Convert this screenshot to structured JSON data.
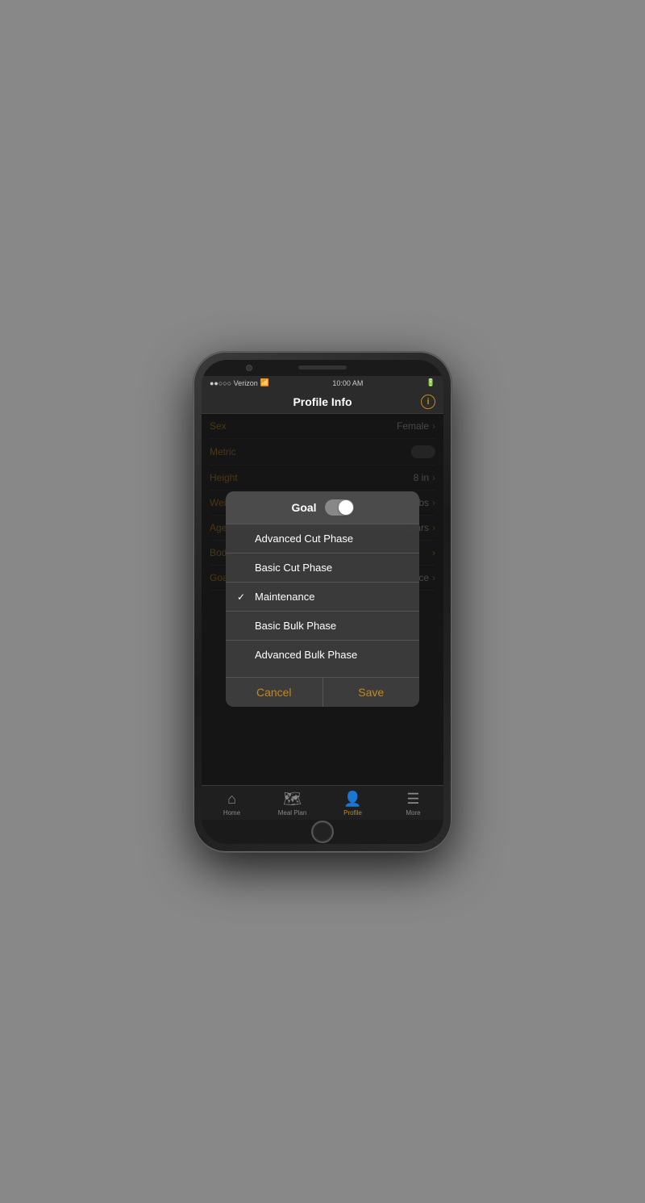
{
  "statusBar": {
    "carrier": "●●○○○ Verizon",
    "wifi": "WiFi",
    "time": "10:00 AM",
    "battery": "Battery"
  },
  "navBar": {
    "title": "Profile Info",
    "infoButton": "i"
  },
  "profileRows": [
    {
      "label": "Sex",
      "value": "Female",
      "hasChevron": true
    },
    {
      "label": "Metric",
      "value": "",
      "hasToggle": true
    },
    {
      "label": "Height",
      "value": "8 in",
      "hasChevron": true
    },
    {
      "label": "Weight",
      "value": "lbs",
      "hasChevron": true
    },
    {
      "label": "Age",
      "value": "years",
      "hasChevron": true
    },
    {
      "label": "Body",
      "value": "",
      "hasChevron": true
    },
    {
      "label": "Goal",
      "value": "nce",
      "hasChevron": true
    }
  ],
  "dialog": {
    "title": "Goal",
    "options": [
      {
        "text": "Advanced Cut Phase",
        "selected": false
      },
      {
        "text": "Basic Cut Phase",
        "selected": false
      },
      {
        "text": "Maintenance",
        "selected": true
      },
      {
        "text": "Basic Bulk Phase",
        "selected": false
      },
      {
        "text": "Advanced Bulk Phase",
        "selected": false
      }
    ],
    "cancelLabel": "Cancel",
    "saveLabel": "Save"
  },
  "tabBar": {
    "tabs": [
      {
        "label": "Home",
        "icon": "⌂",
        "active": false
      },
      {
        "label": "Meal Plan",
        "icon": "🗺",
        "active": false
      },
      {
        "label": "Profile",
        "icon": "👤",
        "active": true
      },
      {
        "label": "More",
        "icon": "☰",
        "active": false
      }
    ]
  }
}
